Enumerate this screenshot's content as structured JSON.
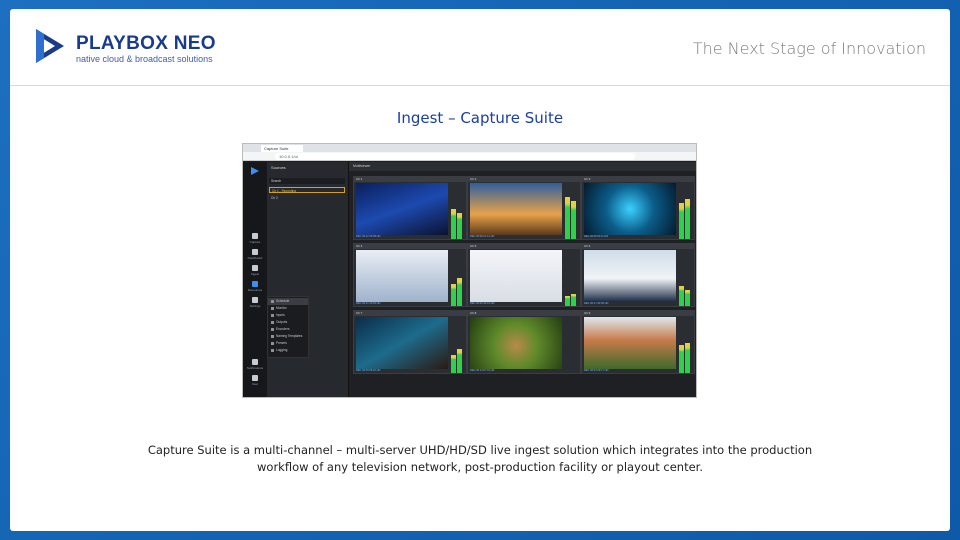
{
  "header": {
    "logo_name": "PLAYBOX NEO",
    "logo_tagline": "native cloud & broadcast solutions",
    "tagline": "The Next Stage of Innovation"
  },
  "slide": {
    "title": "Ingest – Capture Suite",
    "caption_line1": "Capture Suite is a multi-channel – multi-server UHD/HD/SD live ingest solution which integrates into the production",
    "caption_line2": "workflow of any television network, post-production facility or playout center."
  },
  "colors": {
    "background": "#1565b5",
    "logo_blue": "#1a3b8c",
    "title_blue": "#1a3ea6"
  },
  "screenshot": {
    "browser_tab": "Capture Suite",
    "url": "10.0.0.1/ui",
    "rail_items": [
      "Capture",
      "Dashboard",
      "Ingest",
      "Resources",
      "Settings",
      "Notifications",
      "User"
    ],
    "sources_header": "Sources",
    "source_rows": [
      "Search",
      "Ch 1 - Recording",
      "Ch 2"
    ],
    "menu_items": [
      "Schedule",
      "Monitor",
      "Inputs",
      "Outputs",
      "Encoders",
      "Naming Templates",
      "Presets",
      "Logging"
    ],
    "main_header": "Multiviewer",
    "tiles": [
      {
        "label": "Ch 1",
        "footer": "REC 00:12:45:08  HD"
      },
      {
        "label": "Ch 2",
        "footer": "REC 00:08:21:14  HD"
      },
      {
        "label": "Ch 3",
        "footer": "REC 00:05:02:11  HD"
      },
      {
        "label": "Ch 4",
        "footer": "REC 00:21:10:03  HD"
      },
      {
        "label": "Ch 5",
        "footer": "REC 00:02:44:19  HD"
      },
      {
        "label": "Ch 6",
        "footer": "REC 00:17:33:06  HD"
      },
      {
        "label": "Ch 7",
        "footer": "REC 00:09:58:22  HD"
      },
      {
        "label": "Ch 8",
        "footer": "REC 00:14:07:01  HD"
      },
      {
        "label": "Ch 9",
        "footer": "REC 00:03:29:17  HD"
      }
    ]
  }
}
